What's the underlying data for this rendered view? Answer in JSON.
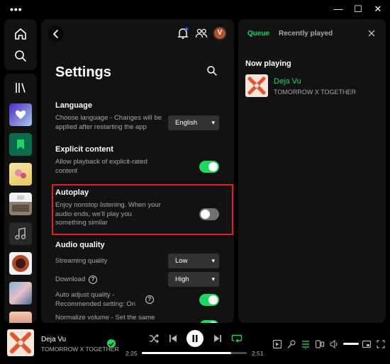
{
  "window": {
    "menu_dots": "•••",
    "minimize": "—",
    "maximize": "☐",
    "close": "✕"
  },
  "header": {
    "avatar_letter": "V"
  },
  "settings": {
    "title": "Settings",
    "language": {
      "heading": "Language",
      "text": "Choose language - Changes will be applied after restarting the app",
      "value": "English"
    },
    "explicit": {
      "heading": "Explicit content",
      "text": "Allow playback of explicit-rated content",
      "enabled": true
    },
    "autoplay": {
      "heading": "Autoplay",
      "text": "Enjoy nonstop listening. When your audio ends, we'll play you something similar",
      "enabled": false
    },
    "audio_quality": {
      "heading": "Audio quality",
      "streaming_label": "Streaming quality",
      "streaming_value": "Low",
      "download_label": "Download",
      "download_value": "High",
      "auto_adjust_label": "Auto adjust quality - Recommended setting: On",
      "auto_adjust_enabled": true,
      "normalize_label": "Normalize volume - Set the same",
      "normalize_enabled": true
    }
  },
  "queue_panel": {
    "tab_queue": "Queue",
    "tab_recent": "Recently played",
    "now_playing_heading": "Now playing",
    "track_title": "Deja Vu",
    "track_artist": "TOMORROW X TOGETHER"
  },
  "player": {
    "track_title": "Deja Vu",
    "track_artist": "TOMORROW X TOGETHER",
    "elapsed": "2:25",
    "duration": "2:51",
    "progress_fraction": 0.85
  },
  "colors": {
    "accent": "#1ed760",
    "highlight": "#e0212f",
    "panel": "#121212"
  }
}
